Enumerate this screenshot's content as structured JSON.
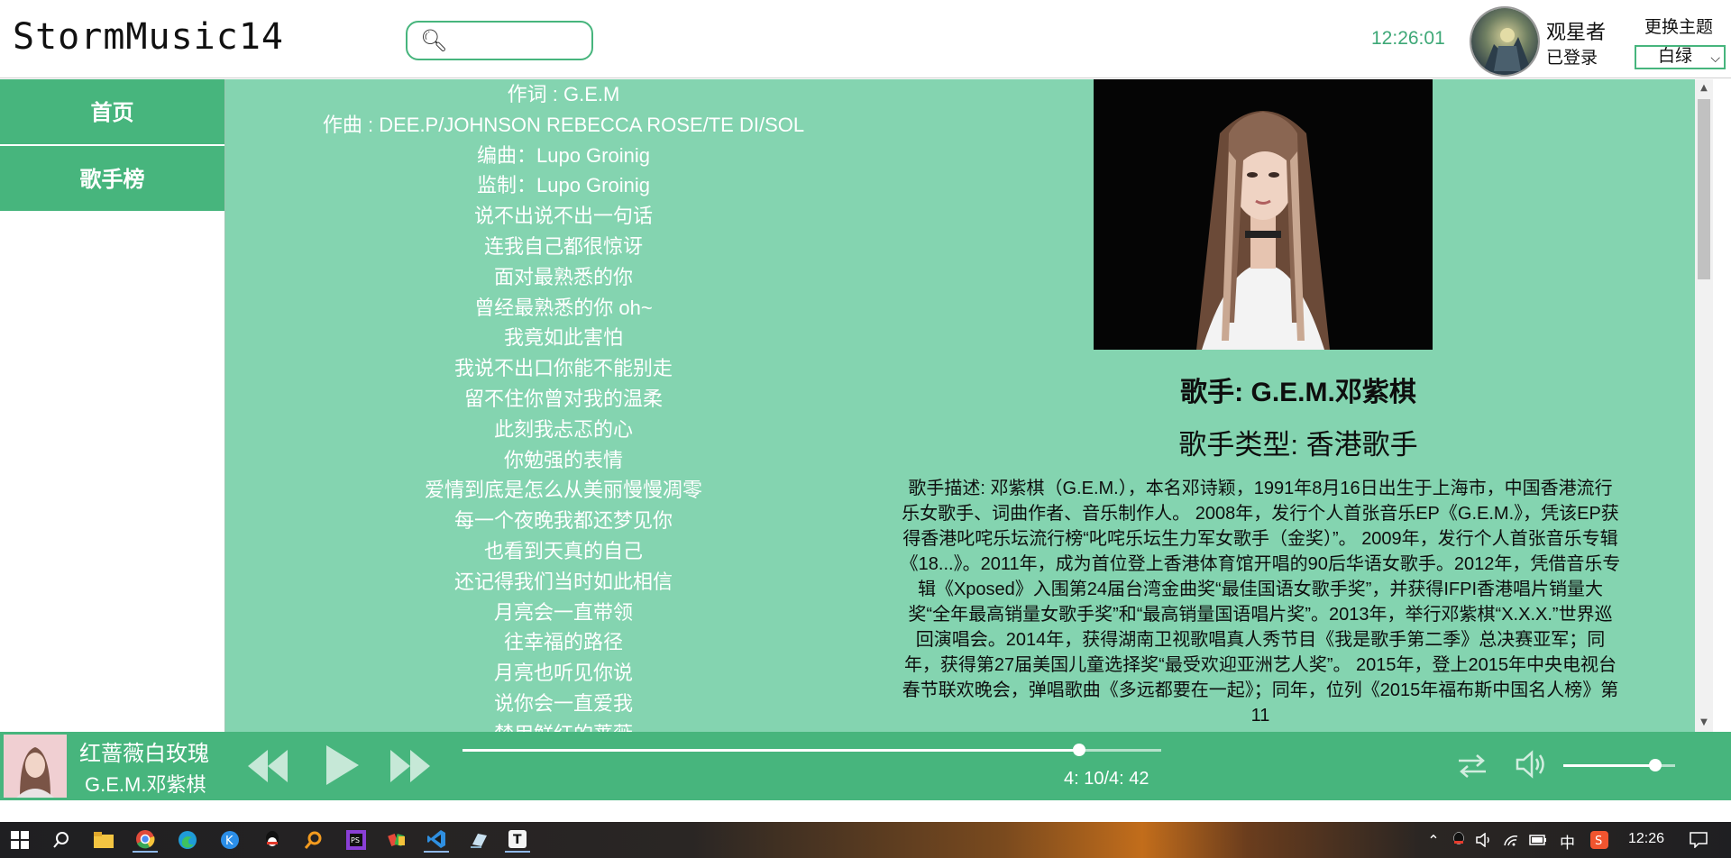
{
  "header": {
    "logo": "StormMusic14",
    "search_placeholder": "",
    "clock": "12:26:01",
    "user_name": "观星者",
    "user_status": "已登录",
    "theme_label": "更换主题",
    "theme_selected": "白绿"
  },
  "sidebar": {
    "items": [
      {
        "label": "首页"
      },
      {
        "label": "歌手榜"
      }
    ]
  },
  "lyrics": [
    "作词 : G.E.M",
    "作曲 : DEE.P/JOHNSON REBECCA ROSE/TE DI/SOL",
    "编曲：Lupo Groinig",
    "监制：Lupo Groinig",
    "说不出说不出一句话",
    "连我自己都很惊讶",
    "面对最熟悉的你",
    "曾经最熟悉的你 oh~",
    "我竟如此害怕",
    "我说不出口你能不能别走",
    "留不住你曾对我的温柔",
    "此刻我忐忑的心",
    "你勉强的表情",
    "爱情到底是怎么从美丽慢慢凋零",
    "每一个夜晚我都还梦见你",
    "也看到天真的自己",
    "还记得我们当时如此相信",
    "月亮会一直带领",
    "往幸福的路径",
    "月亮也听见你说",
    "说你会一直爱我",
    "禁用鲜红的蔷薇"
  ],
  "singer": {
    "name": "歌手: G.E.M.邓紫棋",
    "type": "歌手类型: 香港歌手",
    "description": "歌手描述: 邓紫棋（G.E.M.），本名邓诗颖，1991年8月16日出生于上海市，中国香港流行乐女歌手、词曲作者、音乐制作人。 2008年，发行个人首张音乐EP《G.E.M.》，凭该EP获得香港叱咤乐坛流行榜“叱咤乐坛生力军女歌手（金奖）”。 2009年，发行个人首张音乐专辑《18...》。2011年，成为首位登上香港体育馆开唱的90后华语女歌手。2012年，凭借音乐专辑《Xposed》入围第24届台湾金曲奖“最佳国语女歌手奖”，并获得IFPI香港唱片销量大奖“全年最高销量女歌手奖”和“最高销量国语唱片奖”。2013年，举行邓紫棋“X.X.X.”世界巡回演唱会。2014年，获得湖南卫视歌唱真人秀节目《我是歌手第二季》总决赛亚军；同年，获得第27届美国儿童选择奖“最受欢迎亚洲艺人奖”。 2015年，登上2015年中央电视台春节联欢晚会，弹唱歌曲《多远都要在一起》；同年，位列《2015年福布斯中国名人榜》第11"
  },
  "player": {
    "song_title": "红蔷薇白玫瑰",
    "song_artist": "G.E.M.邓紫棋",
    "time_display": "4: 10/4: 42",
    "progress_fraction": 0.883,
    "volume_fraction": 0.82
  },
  "taskbar": {
    "time": "12:26",
    "ime": "中"
  },
  "colors": {
    "accent": "#47b57d",
    "main_bg": "#84d4b0",
    "clock": "#3ea877"
  }
}
